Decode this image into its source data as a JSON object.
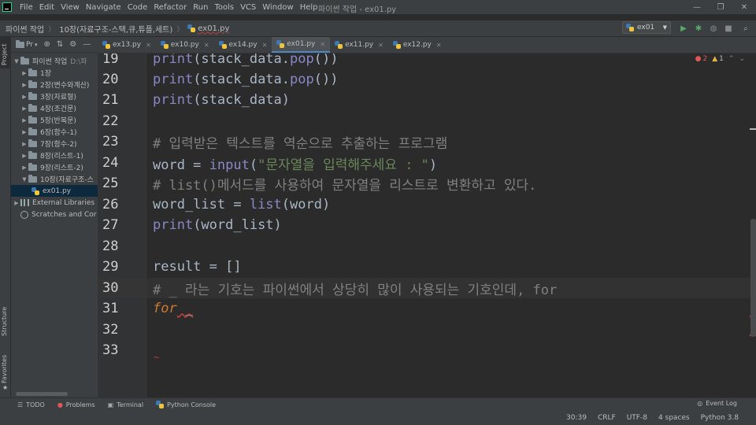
{
  "menu": {
    "items": [
      "File",
      "Edit",
      "View",
      "Navigate",
      "Code",
      "Refactor",
      "Run",
      "Tools",
      "VCS",
      "Window",
      "Help"
    ],
    "window_title": "파이썬 작업 - ex01.py"
  },
  "navbar": {
    "crumbs": [
      "파이썬 작업",
      "10장(자료구조-스택,큐,튜플,세트)",
      "ex01.py"
    ],
    "run_config": "ex01"
  },
  "left_strip": {
    "project": "Project",
    "structure": "Structure",
    "favorites": "Favorites"
  },
  "project_panel": {
    "toolbar_label": "Pr",
    "root": "파이썬 작업",
    "root_path": "D:\\파",
    "folders": [
      "1장",
      "2장(변수와계산)",
      "3장(자료형)",
      "4장(조건문)",
      "5장(반복문)",
      "6장(함수-1)",
      "7장(함수-2)",
      "8장(리스트-1)",
      "9장(리스트-2)",
      "10장(자료구조-스"
    ],
    "file": "ex01.py",
    "external_libraries": "External Libraries",
    "scratches": "Scratches and Cor"
  },
  "tabs": [
    "ex13.py",
    "ex10.py",
    "ex14.py",
    "ex01.py",
    "ex11.py",
    "ex12.py"
  ],
  "inspections": {
    "errors": "2",
    "warnings": "1"
  },
  "editor": {
    "lines": [
      {
        "n": "19",
        "t1": "print",
        "t2": "(stack_data.",
        "t3": "pop",
        "t4": "())"
      },
      {
        "n": "20",
        "t1": "print",
        "t2": "(stack_data.",
        "t3": "pop",
        "t4": "())"
      },
      {
        "n": "21",
        "t1": "print",
        "t2": "(stack_data)"
      },
      {
        "n": "22"
      },
      {
        "n": "23",
        "comment": "# 입력받은 텍스트를 역순으로 추출하는 프로그램"
      },
      {
        "n": "24",
        "t1": "word = ",
        "t2": "input",
        "t3": "(",
        "t4": "\"문자열을 입력해주세요 : \"",
        "t5": ")"
      },
      {
        "n": "25",
        "comment": "# list()메서드를 사용하여 문자열을 리스트로 변환하고 있다."
      },
      {
        "n": "26",
        "t1": "word_list = ",
        "t2": "list",
        "t3": "(word)"
      },
      {
        "n": "27",
        "t1": "print",
        "t2": "(word_list)"
      },
      {
        "n": "28"
      },
      {
        "n": "29",
        "t1": "result = []"
      },
      {
        "n": "30",
        "comment": "# _ 라는 기호는 파이썬에서 상당히 많이 사용되는 기호인데, for"
      },
      {
        "n": "31",
        "t1": "for",
        "t2": " _"
      },
      {
        "n": "32"
      },
      {
        "n": "33"
      }
    ]
  },
  "bottom_tools": [
    "TODO",
    "Problems",
    "Terminal",
    "Python Console"
  ],
  "event_log": "Event Log",
  "status": {
    "position": "30:39",
    "line_sep": "CRLF",
    "encoding": "UTF-8",
    "indent": "4 spaces",
    "interpreter": "Python 3.8"
  }
}
